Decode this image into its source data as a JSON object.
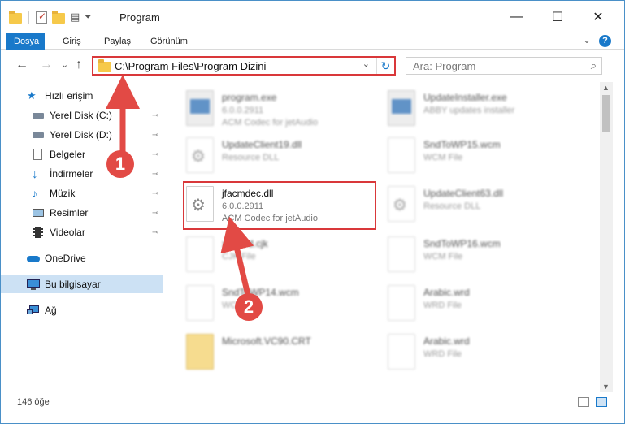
{
  "window": {
    "title": "Program",
    "minimize": "—",
    "maximize": "☐",
    "close": "✕"
  },
  "ribbon": {
    "tabs": [
      "Dosya",
      "Giriş",
      "Paylaş",
      "Görünüm"
    ],
    "expand": "⌄",
    "help": "?"
  },
  "address": {
    "path": "C:\\Program Files\\Program Dizini",
    "dropdown": "⌄",
    "refresh": "↻",
    "search_placeholder": "Ara: Program"
  },
  "nav": {
    "back": "←",
    "forward": "→",
    "recent": "⌄",
    "up": "↑"
  },
  "sidebar": {
    "items": [
      {
        "label": "Hızlı erişim",
        "icon": "star-icon",
        "pinned": false
      },
      {
        "label": "Yerel Disk (C:)",
        "icon": "drive-icon",
        "pinned": true
      },
      {
        "label": "Yerel Disk (D:)",
        "icon": "drive-icon",
        "pinned": true
      },
      {
        "label": "Belgeler",
        "icon": "document-icon",
        "pinned": true
      },
      {
        "label": "İndirmeler",
        "icon": "download-icon",
        "pinned": true
      },
      {
        "label": "Müzik",
        "icon": "music-icon",
        "pinned": true
      },
      {
        "label": "Resimler",
        "icon": "picture-icon",
        "pinned": true
      },
      {
        "label": "Videolar",
        "icon": "video-icon",
        "pinned": true
      },
      {
        "label": "OneDrive",
        "icon": "cloud-icon",
        "pinned": false
      },
      {
        "label": "Bu bilgisayar",
        "icon": "computer-icon",
        "pinned": false
      },
      {
        "label": "Ağ",
        "icon": "network-icon",
        "pinned": false
      }
    ],
    "pin_glyph": "📌"
  },
  "files": [
    {
      "name": "program.exe",
      "meta1": "6.0.0.2911",
      "meta2": "ACM Codec for jetAudio",
      "kind": "exe",
      "blurred": true
    },
    {
      "name": "UpdateInstaller.exe",
      "meta1": "ABBY updates installer",
      "meta2": "",
      "kind": "exe",
      "blurred": true
    },
    {
      "name": "UpdateClient19.dll",
      "meta1": "Resource DLL",
      "meta2": "",
      "kind": "gear",
      "blurred": true
    },
    {
      "name": "SndToWP15.wcm",
      "meta1": "WCM File",
      "meta2": "",
      "kind": "blank",
      "blurred": true
    },
    {
      "name": "jfacmdec.dll",
      "meta1": "6.0.0.2911",
      "meta2": "ACM Codec for jetAudio",
      "kind": "gear",
      "blurred": false
    },
    {
      "name": "UpdateClient63.dll",
      "meta1": "Resource DLL",
      "meta2": "",
      "kind": "gear",
      "blurred": true
    },
    {
      "name": "xlfilrerd.cjk",
      "meta1": "CJK File",
      "meta2": "",
      "kind": "blank",
      "blurred": true
    },
    {
      "name": "SndToWP16.wcm",
      "meta1": "WCM File",
      "meta2": "",
      "kind": "blank",
      "blurred": true
    },
    {
      "name": "SndToWP14.wcm",
      "meta1": "WCM File",
      "meta2": "",
      "kind": "blank",
      "blurred": true
    },
    {
      "name": "Arabic.wrd",
      "meta1": "WRD File",
      "meta2": "",
      "kind": "blank",
      "blurred": true
    },
    {
      "name": "Microsoft.VC90.CRT",
      "meta1": "",
      "meta2": "",
      "kind": "folder",
      "blurred": true
    },
    {
      "name": "Arabic.wrd",
      "meta1": "WRD File",
      "meta2": "",
      "kind": "blank",
      "blurred": true
    }
  ],
  "status": {
    "count": "146 öğe"
  },
  "annotations": [
    "1",
    "2"
  ],
  "colors": {
    "accent": "#1979ca",
    "highlight": "#d9383a",
    "selected": "#cce1f4"
  }
}
